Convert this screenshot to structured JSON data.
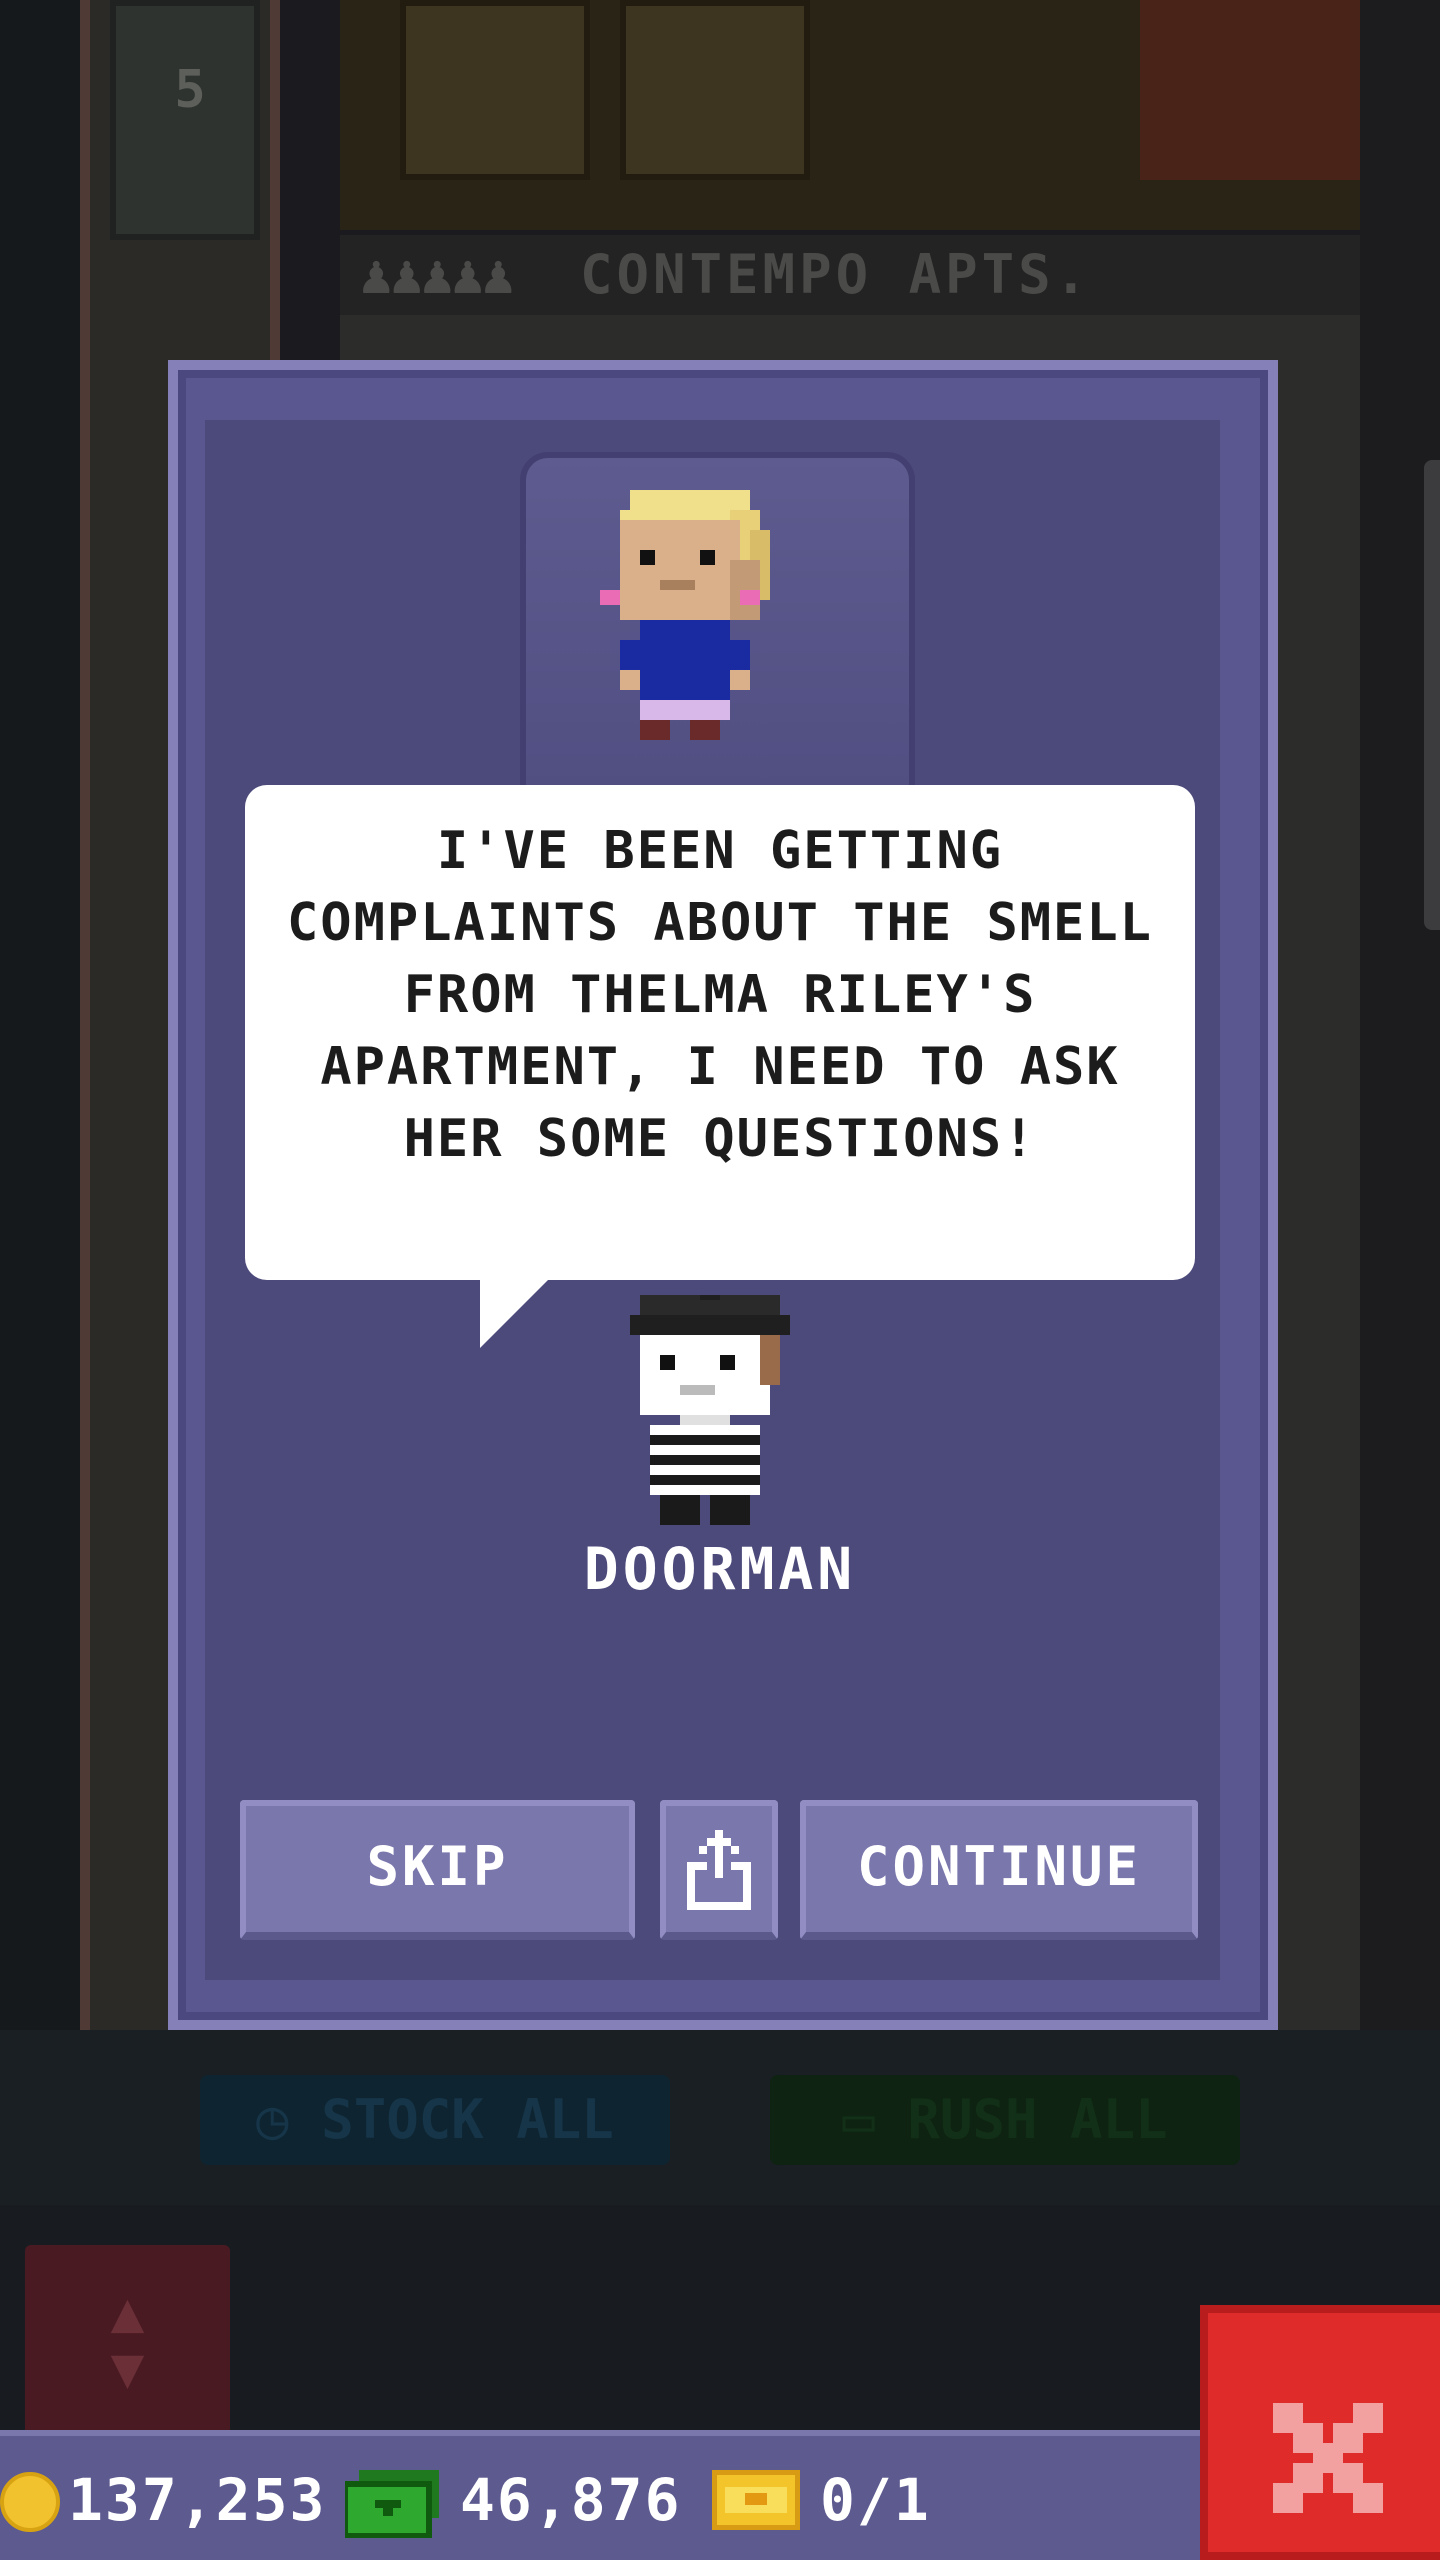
{
  "background": {
    "floor_number": "5",
    "floor_name": "CONTEMPO APTS.",
    "stock_all_label": "STOCK ALL",
    "rush_all_label": "RUSH ALL"
  },
  "dialog": {
    "message": "I'VE BEEN GETTING COMPLAINTS ABOUT THE SMELL FROM THELMA RILEY'S APARTMENT, I NEED TO ASK HER SOME QUESTIONS!",
    "speaker_name": "DOORMAN",
    "skip_label": "SKIP",
    "continue_label": "CONTINUE",
    "share_icon": "share-icon"
  },
  "currency": {
    "coins": "137,253",
    "cash": "46,876",
    "bux": "0/1"
  },
  "colors": {
    "dialog_bg": "#4c4a7a",
    "dialog_border": "#8580b8",
    "button_bg": "#7a77ad",
    "close_red": "#e02b2b",
    "coin_gold": "#f2c12e",
    "cash_green": "#2ea82e"
  }
}
